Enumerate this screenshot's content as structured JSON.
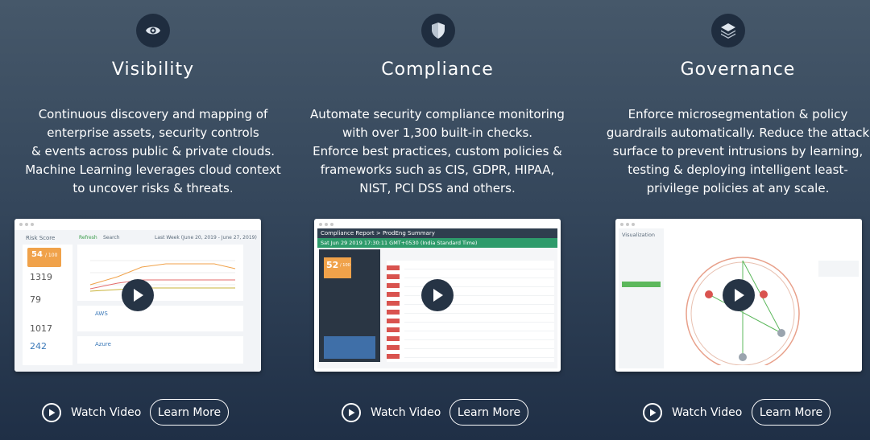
{
  "features": [
    {
      "icon": "eye-icon",
      "title": "Visibility",
      "description": [
        "Continuous discovery and mapping of",
        "enterprise assets, security controls",
        "& events across public & private clouds.",
        "Machine Learning leverages cloud context",
        "to uncover risks & threats."
      ],
      "watch_label": "Watch Video",
      "learn_label": "Learn More",
      "screenshot": {
        "header": "Risk Score",
        "refresh": "Refresh",
        "search": "Search",
        "range": "Last Week (June 20, 2019 - June 27, 2019)",
        "score": "54",
        "score_max": "/ 100",
        "stat1": "1319",
        "stat2": "79",
        "stat3": "1017",
        "stat4": "242",
        "cloud1": "AWS",
        "cloud2": "Azure"
      }
    },
    {
      "icon": "shield-icon",
      "title": "Compliance",
      "description": [
        "Automate security compliance monitoring",
        "with over 1,300 built-in checks.",
        "Enforce best practices, custom policies &",
        "frameworks such as CIS, GDPR, HIPAA,",
        "NIST, PCI DSS and others."
      ],
      "watch_label": "Watch Video",
      "learn_label": "Learn More",
      "screenshot": {
        "header": "Compliance Report > ProdEng Summary",
        "date": "Sat Jun 29 2019 17:30:11 GMT+0530 (India Standard Time)",
        "score": "52",
        "score_max": "/ 100"
      }
    },
    {
      "icon": "layers-icon",
      "title": "Governance",
      "description": [
        "Enforce microsegmentation & policy",
        "guardrails automatically. Reduce the attack",
        "surface to prevent intrusions by learning,",
        "testing & deploying intelligent least-",
        "privilege policies at any scale."
      ],
      "watch_label": "Watch Video",
      "learn_label": "Learn More",
      "screenshot": {
        "header": "Visualization"
      }
    }
  ]
}
